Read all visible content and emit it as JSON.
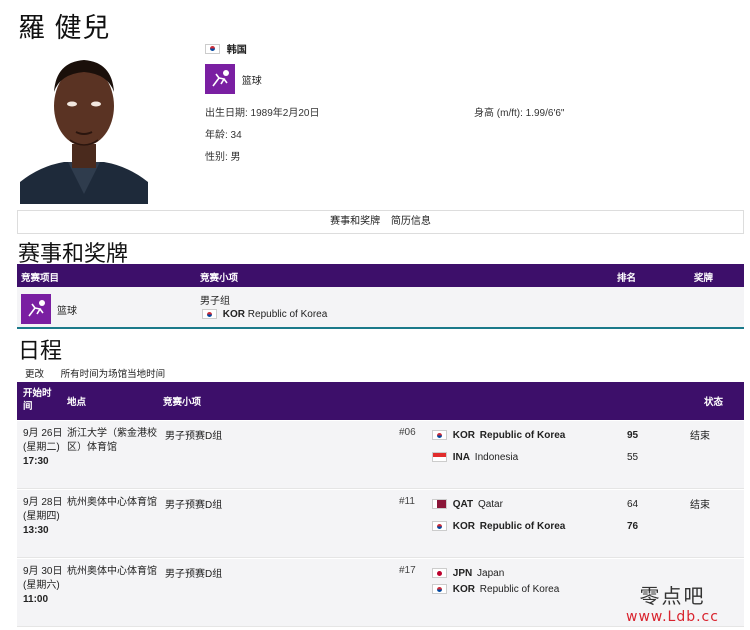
{
  "athlete": {
    "name": "羅 健兒",
    "country": "韩国",
    "sport": "篮球",
    "birth_label": "出生日期: 1989年2月20日",
    "height_label": "身高 (m/ft): 1.99/6'6\"",
    "age_label": "年龄: 34",
    "gender_label": "性别: 男"
  },
  "tabs": [
    "赛事和奖牌",
    "简历信息"
  ],
  "events_section": {
    "title": "赛事和奖牌",
    "headers": [
      "竞赛项目",
      "竞赛小项",
      "排名",
      "奖牌"
    ],
    "row": {
      "sport": "篮球",
      "event": "男子组",
      "noc_code": "KOR",
      "noc_name": "Republic of Korea"
    }
  },
  "schedule": {
    "title": "日程",
    "links": [
      "更改",
      "所有时间为场馆当地时间"
    ],
    "headers": [
      "开始时间",
      "地点",
      "竞赛小项",
      "状态"
    ],
    "rows": [
      {
        "date": "9月 26日 (星期二)",
        "time": "17:30",
        "venue": "浙江大学（紫金港校区）体育馆",
        "phase": "男子预赛D组",
        "num": "#06",
        "team1": {
          "code": "KOR",
          "name": "Republic of Korea",
          "flag": "kr",
          "score": "95",
          "win": true
        },
        "team2": {
          "code": "INA",
          "name": "Indonesia",
          "flag": "id",
          "score": "55",
          "win": false
        },
        "status": "结束"
      },
      {
        "date": "9月 28日 (星期四)",
        "time": "13:30",
        "venue": "杭州奥体中心体育馆",
        "phase": "男子预赛D组",
        "num": "#11",
        "team1": {
          "code": "QAT",
          "name": "Qatar",
          "flag": "qa",
          "score": "64",
          "win": false
        },
        "team2": {
          "code": "KOR",
          "name": "Republic of Korea",
          "flag": "kr",
          "score": "76",
          "win": true
        },
        "status": "结束"
      },
      {
        "date": "9月 30日 (星期六)",
        "time": "11:00",
        "venue": "杭州奥体中心体育馆",
        "phase": "男子预赛D组",
        "num": "#17",
        "team1": {
          "code": "JPN",
          "name": "Japan",
          "flag": "jp",
          "score": "",
          "win": false
        },
        "team2": {
          "code": "KOR",
          "name": "Republic of Korea",
          "flag": "kr",
          "score": "",
          "win": false
        },
        "status": ""
      }
    ]
  },
  "watermark": {
    "main": "零点吧",
    "url": "www.Ldb.cc"
  },
  "colors": {
    "header_purple": "#3d0f6a",
    "sport_icon": "#7a1fa2",
    "accent_teal": "#1b7a8a"
  }
}
